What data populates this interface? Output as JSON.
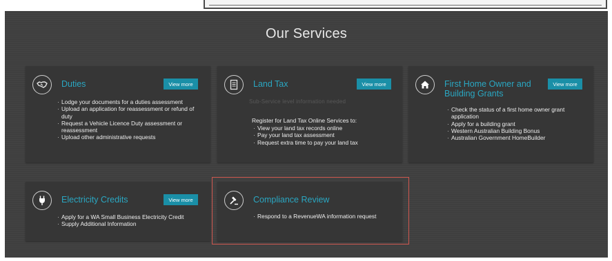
{
  "section": {
    "title": "Our Services"
  },
  "view_more_label": "View more",
  "colors": {
    "panel_bg": "#3f3f3f",
    "card_bg": "#363636",
    "title_teal": "#2aa7c2",
    "button_teal": "#1a8fa7",
    "highlight_red": "#d0574f"
  },
  "cards": {
    "duties": {
      "icon": "handshake-icon",
      "title": "Duties",
      "items": [
        "Lodge your documents for a duties assessment",
        "Upload an application for reassessment or refund of duty",
        "Request a Vehicle Licence Duty assessment or reassessment",
        "Upload other administrative requests"
      ]
    },
    "land_tax": {
      "icon": "document-icon",
      "title": "Land Tax",
      "faded_note": "Sub-Service level information needed",
      "intro": "Register for Land Tax Online Services to:",
      "items": [
        "View your land tax records online",
        "Pay your land tax assessment",
        "Request extra time to pay your land tax"
      ]
    },
    "first_home": {
      "icon": "home-icon",
      "title_line1": "First Home Owner and",
      "title_line2": "Building Grants",
      "items": [
        "Check the status of a first home owner grant application",
        "Apply for a building grant",
        "Western Australian Building Bonus",
        "Australian Government HomeBuilder"
      ]
    },
    "electricity": {
      "icon": "plug-icon",
      "title": "Electricity Credits",
      "items": [
        "Apply for a WA Small Business Electricity Credit",
        "Supply Additional Information"
      ]
    },
    "compliance": {
      "icon": "gavel-icon",
      "title": "Compliance Review",
      "items": [
        "Respond to a RevenueWA information request"
      ]
    }
  }
}
